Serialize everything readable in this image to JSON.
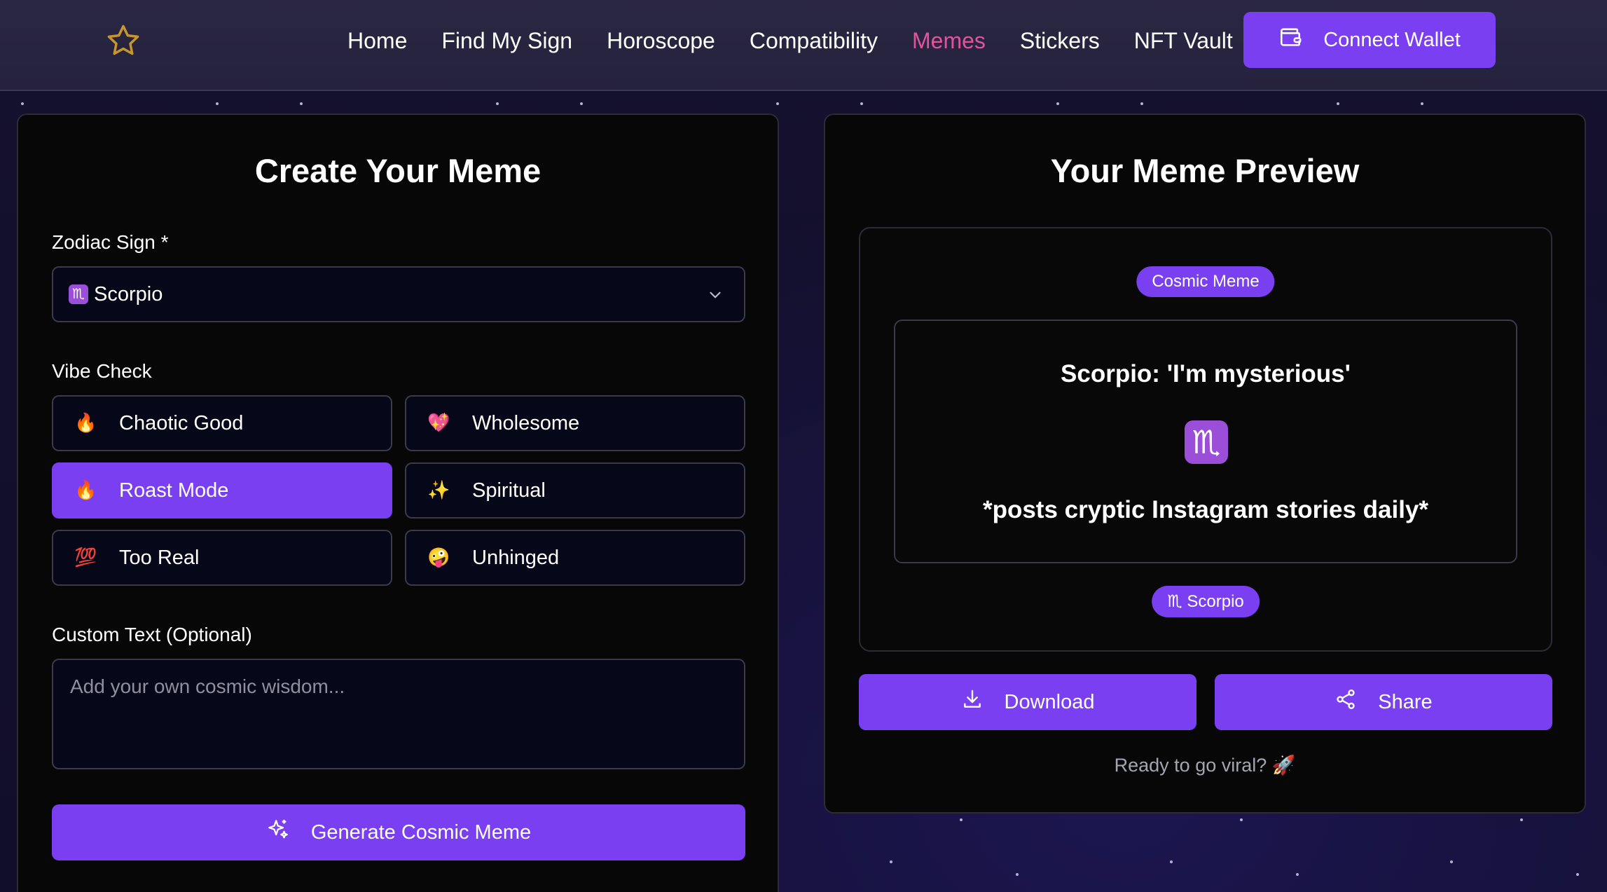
{
  "nav": {
    "logo_icon": "star-outline-icon",
    "links": [
      {
        "label": "Home",
        "active": false
      },
      {
        "label": "Find My Sign",
        "active": false
      },
      {
        "label": "Horoscope",
        "active": false
      },
      {
        "label": "Compatibility",
        "active": false
      },
      {
        "label": "Memes",
        "active": true
      },
      {
        "label": "Stickers",
        "active": false
      },
      {
        "label": "NFT Vault",
        "active": false
      }
    ],
    "wallet_label": "Connect Wallet"
  },
  "create": {
    "title": "Create Your Meme",
    "zodiac_label": "Zodiac Sign *",
    "zodiac_value": "Scorpio",
    "zodiac_glyph": "♏",
    "vibe_label": "Vibe Check",
    "vibes": [
      {
        "emoji": "🔥",
        "label": "Chaotic Good",
        "selected": false
      },
      {
        "emoji": "💖",
        "label": "Wholesome",
        "selected": false
      },
      {
        "emoji": "🔥",
        "label": "Roast Mode",
        "selected": true
      },
      {
        "emoji": "✨",
        "label": "Spiritual",
        "selected": false
      },
      {
        "emoji": "💯",
        "label": "Too Real",
        "selected": false
      },
      {
        "emoji": "🤪",
        "label": "Unhinged",
        "selected": false
      }
    ],
    "custom_label": "Custom Text (Optional)",
    "custom_placeholder": "Add your own cosmic wisdom...",
    "custom_value": "",
    "generate_label": "Generate Cosmic Meme"
  },
  "preview": {
    "title": "Your Meme Preview",
    "badge": "Cosmic Meme",
    "line1": "Scorpio: 'I'm mysterious'",
    "glyph": "♏",
    "line2": "*posts cryptic Instagram stories daily*",
    "sign_glyph": "♏",
    "sign_tag": "Scorpio",
    "download_label": "Download",
    "share_label": "Share",
    "footer": "Ready to go viral? 🚀"
  },
  "colors": {
    "accent": "#7a3ff0",
    "active_link": "#e0559a",
    "panel_bg": "#070708"
  }
}
